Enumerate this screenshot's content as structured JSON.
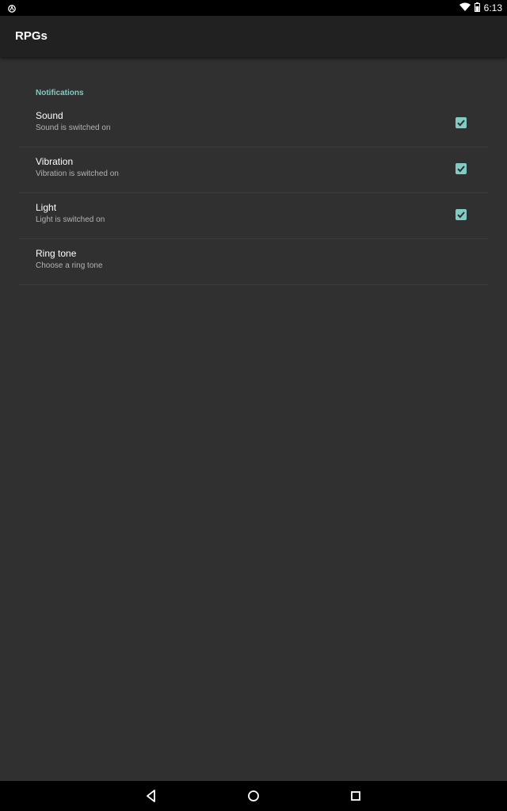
{
  "status_bar": {
    "time": "6:13",
    "left_icon": "android-auto-icon",
    "right_icons": [
      "wifi-icon",
      "battery-icon"
    ]
  },
  "app_bar": {
    "title": "RPGs"
  },
  "preferences": {
    "category": "Notifications",
    "items": [
      {
        "title": "Sound",
        "summary": "Sound is switched on",
        "checked": true
      },
      {
        "title": "Vibration",
        "summary": "Vibration is switched on",
        "checked": true
      },
      {
        "title": "Light",
        "summary": "Light is switched on",
        "checked": true
      },
      {
        "title": "Ring tone",
        "summary": "Choose a ring tone"
      }
    ]
  },
  "nav_bar": {
    "buttons": [
      "back-icon",
      "home-icon",
      "recents-icon"
    ]
  },
  "colors": {
    "accent": "#80cbc4",
    "background": "#303030",
    "app_bar": "#212121"
  }
}
